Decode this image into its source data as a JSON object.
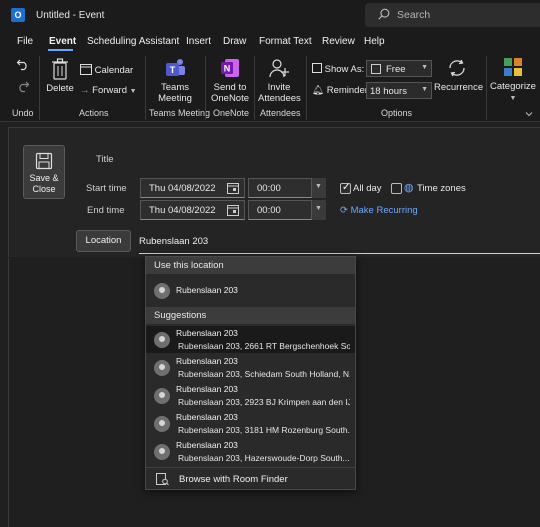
{
  "window": {
    "title": "Untitled  -  Event",
    "app_icon": "outlook-icon",
    "search_placeholder": "Search"
  },
  "menu": [
    "File",
    "Event",
    "Scheduling Assistant",
    "Insert",
    "Draw",
    "Format Text",
    "Review",
    "Help"
  ],
  "ribbon": {
    "undo_label": "Undo",
    "delete_label": "Delete",
    "calendar_label": "Calendar",
    "forward_label": "Forward",
    "actions_label": "Actions",
    "teams_meeting_label": [
      "Teams",
      "Meeting"
    ],
    "teams_meeting_group": "Teams Meeting",
    "send_to_onenote_label": [
      "Send to",
      "OneNote"
    ],
    "onenote_group": "OneNote",
    "invite_label": [
      "Invite",
      "Attendees"
    ],
    "attendees_group": "Attendees",
    "show_as_label": "Show As:",
    "show_as_value": "Free",
    "reminder_label": "Reminder:",
    "reminder_value": "18 hours",
    "recurrence_label": "Recurrence",
    "options_group": "Options",
    "categorize_label": "Categorize",
    "colors": {
      "bg": "#1b1b1b",
      "accent": "#6aa8ff"
    }
  },
  "form": {
    "save_close_label": [
      "Save &",
      "Close"
    ],
    "title_label": "Title",
    "start_time_label": "Start time",
    "end_time_label": "End time",
    "start_date": "Thu 04/08/2022",
    "start_time": "00:00",
    "end_date": "Thu 04/08/2022",
    "end_time": "00:00",
    "all_day_label": "All day",
    "all_day_checked": true,
    "time_zones_label": "Time zones",
    "make_recurring_label": "Make Recurring",
    "location_button_label": "Location",
    "location_value": "Rubenslaan 203"
  },
  "location_dropdown": {
    "use_header": "Use this location",
    "use_item": "Rubenslaan 203",
    "suggestions_header": "Suggestions",
    "suggestions": [
      {
        "title": "Rubenslaan 203",
        "detail": "Rubenslaan 203, 2661 RT  Bergschenhoek  So..."
      },
      {
        "title": "Rubenslaan 203",
        "detail": "Rubenslaan 203, Schiedam  South Holland, N..."
      },
      {
        "title": "Rubenslaan 203",
        "detail": "Rubenslaan 203, 2923 BJ  Krimpen aan den IJs..."
      },
      {
        "title": "Rubenslaan 203",
        "detail": "Rubenslaan 203, 3181 HM  Rozenburg  South..."
      },
      {
        "title": "Rubenslaan 203",
        "detail": "Rubenslaan 203, Hazerswoude-Dorp  South..."
      }
    ],
    "browse_label": "Browse with Room Finder"
  }
}
